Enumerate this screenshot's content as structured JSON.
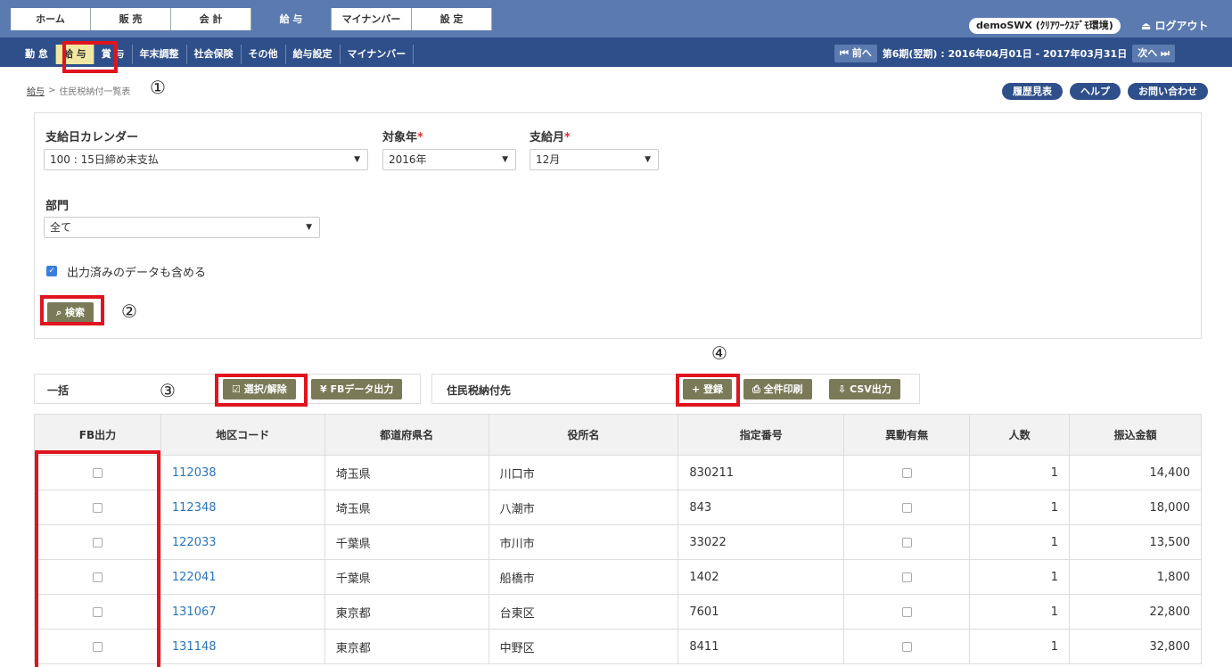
{
  "topnav": {
    "tabs": [
      "ホーム",
      "販 売",
      "会 計",
      "給 与",
      "マイナンバー",
      "設 定"
    ],
    "user": "demoSWX (ｸﾘｱﾜｰｸｽﾃﾞﾓ環境)",
    "logout": "ログアウト"
  },
  "subnav": {
    "items": [
      "勤 怠",
      "給 与",
      "賞 与",
      "年末調整",
      "社会保険",
      "その他",
      "給与設定",
      "マイナンバー"
    ],
    "prev": "前へ",
    "next": "次へ",
    "period": "第6期(翌期) : 2016年04月01日 - 2017年03月31日"
  },
  "breadcrumb": {
    "parent": "給与",
    "sep": ">",
    "current": "住民税納付一覧表"
  },
  "pills": [
    "履歴見表",
    "ヘルプ",
    "お問い合わせ"
  ],
  "search": {
    "calendar_label": "支給日カレンダー",
    "calendar_value": "100 : 15日締め末支払",
    "year_label": "対象年",
    "year_value": "2016年",
    "month_label": "支給月",
    "month_value": "12月",
    "required_mark": "*",
    "dept_label": "部門",
    "dept_value": "全て",
    "include_output_label": "出力済みのデータも含める",
    "search_button": "検索"
  },
  "annotations": [
    "①",
    "②",
    "③",
    "④"
  ],
  "bulk": {
    "title": "一括",
    "select_toggle": "選択/解除",
    "fb_output": "FBデータ出力"
  },
  "payee": {
    "title": "住民税納付先",
    "register": "登録",
    "print_all": "全件印刷",
    "csv": "CSV出力"
  },
  "table": {
    "headers": [
      "FB出力",
      "地区コード",
      "都道府県名",
      "役所名",
      "指定番号",
      "異動有無",
      "人数",
      "振込金額"
    ],
    "rows": [
      {
        "code": "112038",
        "pref": "埼玉県",
        "office": "川口市",
        "number": "830211",
        "count": "1",
        "amount": "14,400"
      },
      {
        "code": "112348",
        "pref": "埼玉県",
        "office": "八潮市",
        "number": "843",
        "count": "1",
        "amount": "18,000"
      },
      {
        "code": "122033",
        "pref": "千葉県",
        "office": "市川市",
        "number": "33022",
        "count": "1",
        "amount": "13,500"
      },
      {
        "code": "122041",
        "pref": "千葉県",
        "office": "船橋市",
        "number": "1402",
        "count": "1",
        "amount": "1,800"
      },
      {
        "code": "131067",
        "pref": "東京都",
        "office": "台東区",
        "number": "7601",
        "count": "1",
        "amount": "22,800"
      },
      {
        "code": "131148",
        "pref": "東京都",
        "office": "中野区",
        "number": "8411",
        "count": "1",
        "amount": "32,800"
      }
    ]
  }
}
